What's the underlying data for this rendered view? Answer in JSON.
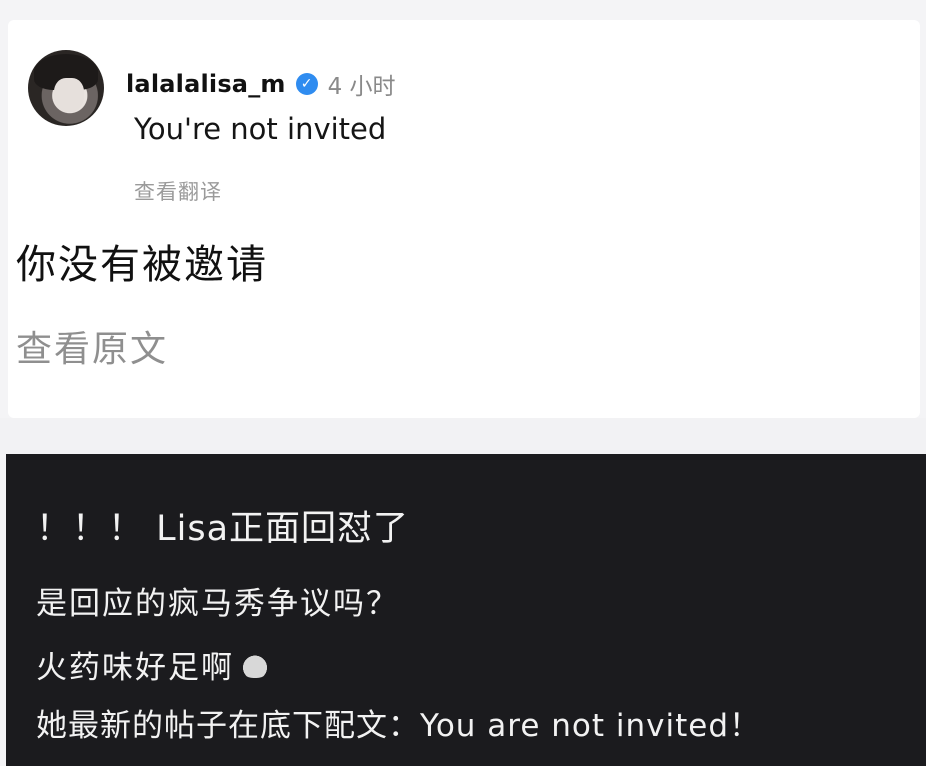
{
  "post": {
    "username": "lalalalisa_m",
    "time": "4 小时",
    "comment": "You're not invited",
    "see_translation": "查看翻译",
    "translated_text": "你没有被邀请",
    "see_original": "查看原文"
  },
  "caption": {
    "line1": "！！！ Lisa正面回怼了",
    "line2": "是回应的疯马秀争议吗？",
    "line3": "火药味好足啊",
    "line4": "她最新的帖子在底下配文：You are not invited！"
  }
}
